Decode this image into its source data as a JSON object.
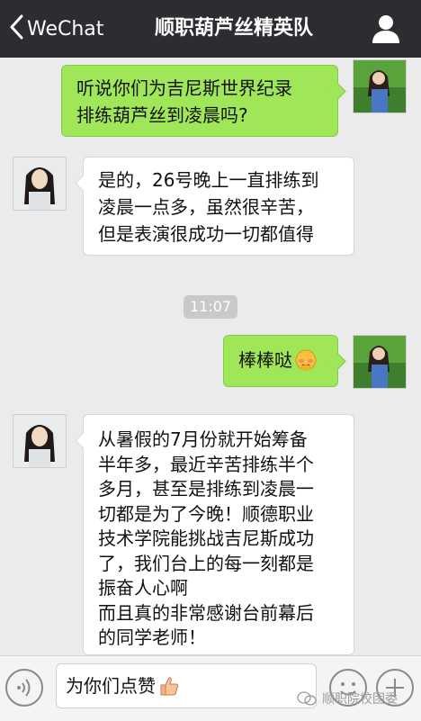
{
  "header": {
    "back_label": "WeChat",
    "title": "顺职葫芦丝精英队"
  },
  "messages": [
    {
      "side": "right",
      "lines": [
        "听说你们为吉尼斯世界纪录",
        "排练葫芦丝到凌晨吗?"
      ]
    },
    {
      "side": "left",
      "lines": [
        "是的，26号晚上一直排练到",
        "凌晨一点多，虽然很辛苦，",
        "但是表演很成功一切都值得"
      ]
    },
    {
      "side": "right",
      "text": "棒棒哒",
      "emoji": "shy-face-emoji"
    },
    {
      "side": "left",
      "lines": [
        "从暑假的7月份就开始筹备",
        "半年多，最近辛苦排练半个",
        "多月，甚至是排练到凌晨一",
        "切都是为了今晚！顺德职业",
        "技术学院能挑战吉尼斯成功",
        "了，我们台上的每一刻都是",
        "振奋人心啊",
        "而且真的非常感谢台前幕后",
        "的同学老师！"
      ]
    }
  ],
  "timestamp": "11:07",
  "input": {
    "value": "为你们点赞",
    "emoji": "thumbs-up-emoji"
  },
  "watermark": "顺职院校团委",
  "colors": {
    "header_bg": "#2b2d30",
    "outgoing_bubble": "#9fe658",
    "incoming_bubble": "#ffffff",
    "chat_bg": "#ebebeb"
  }
}
